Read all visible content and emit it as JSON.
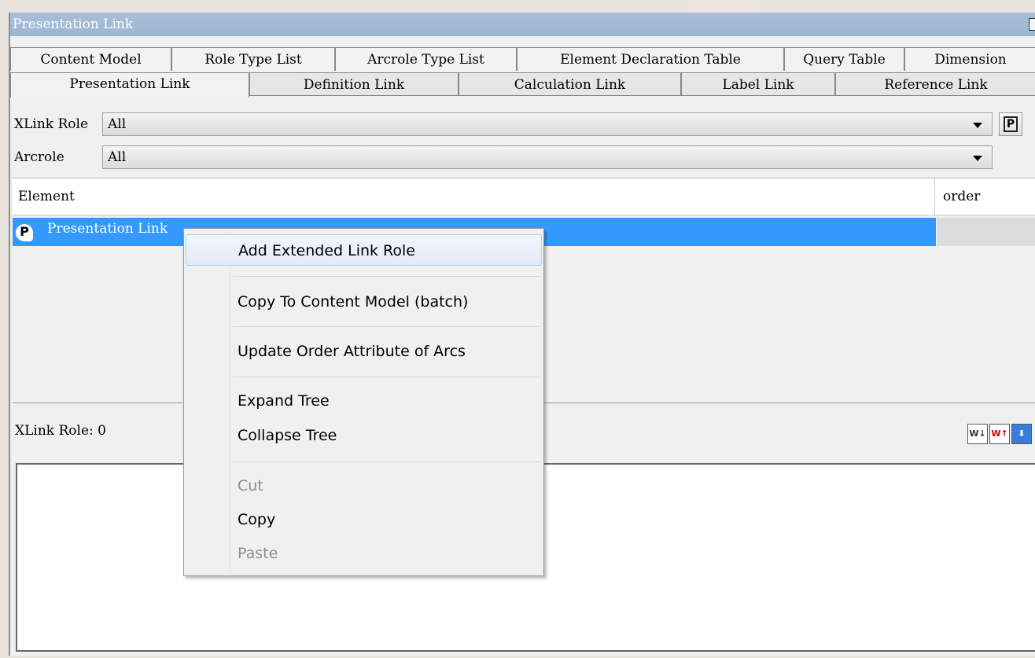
{
  "window": {
    "title": "Presentation Link"
  },
  "tabs_row1": [
    "Content Model",
    "Role Type List",
    "Arcrole Type List",
    "Element Declaration Table",
    "Query Table",
    "Dimension"
  ],
  "tabs_row2": [
    "Presentation Link",
    "Definition Link",
    "Calculation Link",
    "Label Link",
    "Reference Link"
  ],
  "active_tab": "Presentation Link",
  "filters": {
    "xlink_role_label": "XLink Role",
    "xlink_role_value": "All",
    "arcrole_label": "Arcrole",
    "arcrole_value": "All"
  },
  "tree": {
    "columns": [
      "Element",
      "order"
    ],
    "rows": [
      {
        "icon": "P",
        "label": "Presentation Link",
        "order": ""
      }
    ]
  },
  "status": {
    "text": "XLink Role: 0"
  },
  "status_buttons": [
    "move-down-icon",
    "move-up-icon",
    "arrow-down-icon"
  ],
  "context_menu": {
    "items": [
      {
        "label": "Add Extended Link Role",
        "enabled": true,
        "hover": true
      },
      {
        "label": "Copy To Content Model (batch)",
        "enabled": true
      },
      {
        "label": "Update Order Attribute of Arcs",
        "enabled": true
      },
      {
        "label": "Expand Tree",
        "enabled": true
      },
      {
        "label": "Collapse Tree",
        "enabled": true
      },
      {
        "label": "Cut",
        "enabled": false
      },
      {
        "label": "Copy",
        "enabled": true
      },
      {
        "label": "Paste",
        "enabled": false
      }
    ]
  },
  "colors": {
    "titlebar": "#9db5d2",
    "selection": "#3399ff"
  }
}
